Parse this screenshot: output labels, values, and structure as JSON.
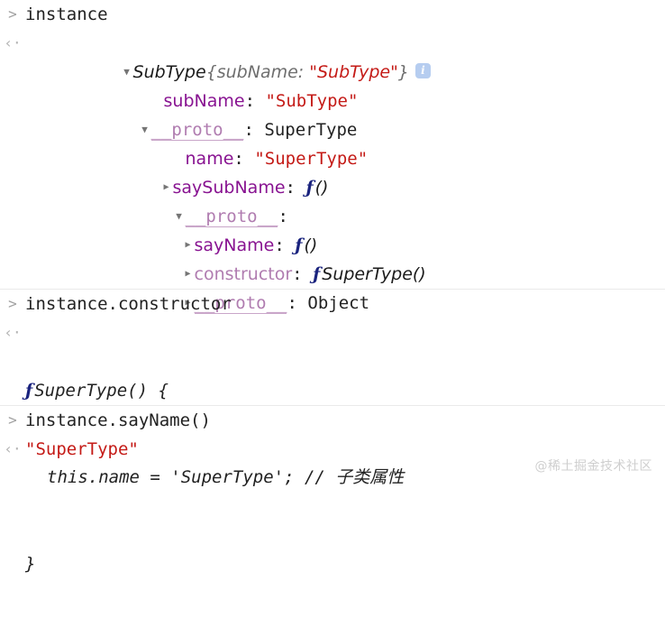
{
  "console": {
    "input_marker": ">",
    "output_marker": "‹·",
    "info_badge": "i",
    "groups": [
      {
        "name": "instance-evaluation",
        "input": "instance",
        "object_tree": {
          "root": {
            "constructor_name": "SubType",
            "preview": "{subName:",
            "preview_value": "\"SubType\"",
            "preview_close": "}"
          },
          "nodes": [
            {
              "key": "subName",
              "key_style": "own",
              "sep": ":",
              "value": "\"SubType\"",
              "value_style": "string",
              "toggle": "none",
              "depth": 1
            },
            {
              "key": "__proto__",
              "key_style": "proto",
              "sep": ":",
              "value": "SuperType",
              "value_style": "objname",
              "toggle": "open",
              "depth": 1
            },
            {
              "key": "name",
              "key_style": "own",
              "sep": ":",
              "value": "\"SuperType\"",
              "value_style": "string",
              "toggle": "none",
              "depth": 2
            },
            {
              "key": "saySubName",
              "key_style": "own",
              "sep": ":",
              "value": "()",
              "value_style": "fn",
              "toggle": "closed",
              "depth": 2
            },
            {
              "key": "__proto__",
              "key_style": "proto",
              "sep": ":",
              "value": "",
              "value_style": "plain",
              "toggle": "open",
              "depth": 2
            },
            {
              "key": "sayName",
              "key_style": "own",
              "sep": ":",
              "value": "()",
              "value_style": "fn",
              "toggle": "closed",
              "depth": 3
            },
            {
              "key": "constructor",
              "key_style": "dim",
              "sep": ":",
              "value": "SuperType()",
              "value_style": "fn",
              "toggle": "closed",
              "depth": 3
            },
            {
              "key": "__proto__",
              "key_style": "proto",
              "sep": ":",
              "value": "Object",
              "value_style": "objname",
              "toggle": "closed",
              "depth": 3
            }
          ]
        }
      },
      {
        "name": "constructor-evaluation",
        "input": "instance.constructor",
        "function_source": {
          "fn_glyph": "ƒ",
          "signature": "SuperType() {",
          "body": "this.name = 'SuperType'; // 子类属性",
          "close": "}"
        }
      },
      {
        "name": "sayname-evaluation",
        "input": "instance.sayName()",
        "output": "\"SuperType\""
      }
    ]
  },
  "watermark": "@稀土掘金技术社区",
  "colors": {
    "background": "#ffffff",
    "text": "#222222",
    "string": "#c41a16",
    "property": "#881391",
    "property_dim": "#b07cb0",
    "function_glyph": "#1a237e",
    "gutter": "#9a9a9a",
    "divider": "#eaeaea",
    "info_badge_bg": "#b6cdf0",
    "watermark": "#cfcfcf"
  }
}
